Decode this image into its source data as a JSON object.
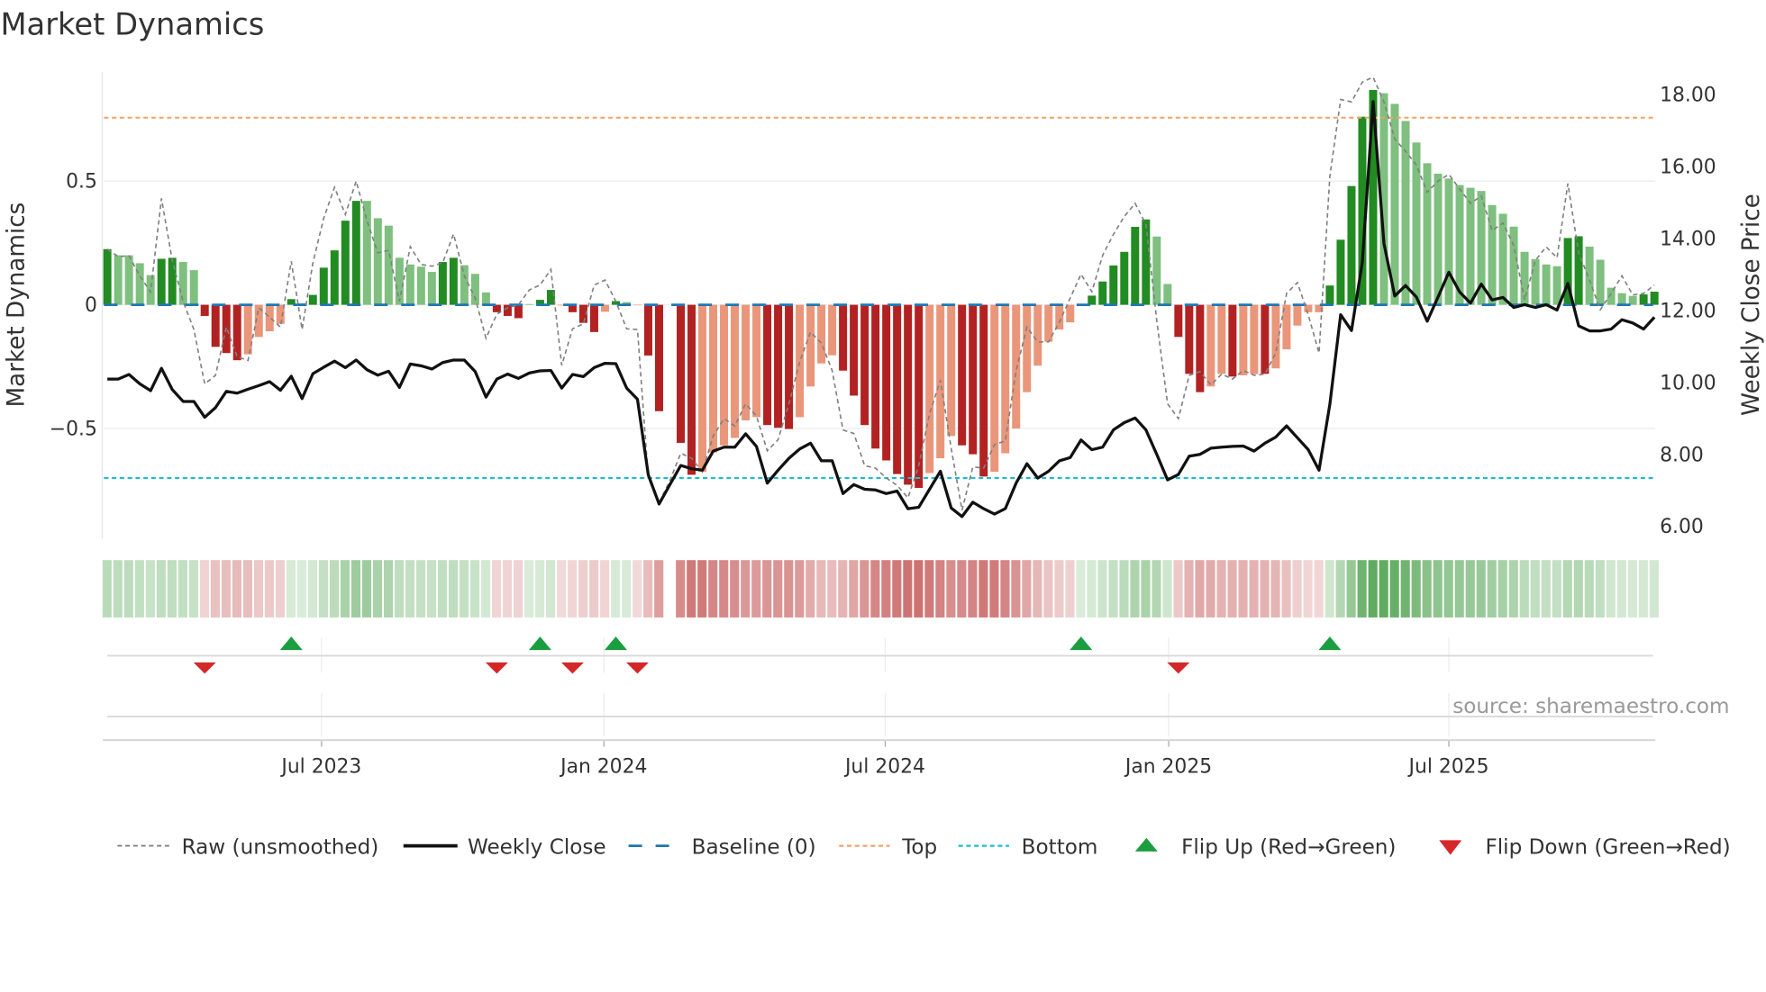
{
  "title": "Market Dynamics",
  "source": "source: sharemaestro.com",
  "colors": {
    "strong_up": "#228b22",
    "weak_up": "#7fbf7f",
    "strong_down": "#b22222",
    "weak_down": "#e9967a",
    "close": "#111111",
    "raw": "#808080",
    "baseline": "#1f77b4",
    "top": "#f4a261",
    "bottom": "#17becf",
    "flip_up": "#1a9e3f",
    "flip_down": "#d62728"
  },
  "chart_data": {
    "type": "bar",
    "title": "Market Dynamics",
    "ylabel": "Market Dynamics",
    "ylabel_right": "Weekly Close Price",
    "ylim": [
      -0.95,
      0.95
    ],
    "ylim_right": [
      5.7,
      18.8
    ],
    "y_ticks": [
      {
        "value": 0.5,
        "label": "0.5"
      },
      {
        "value": 0,
        "label": "0"
      },
      {
        "value": -0.5,
        "label": "−0.5"
      }
    ],
    "y_ticks_right": [
      {
        "value": 18,
        "label": "18.00"
      },
      {
        "value": 16,
        "label": "16.00"
      },
      {
        "value": 14,
        "label": "14.00"
      },
      {
        "value": 12,
        "label": "12.00"
      },
      {
        "value": 10,
        "label": "10.00"
      },
      {
        "value": 8,
        "label": "8.00"
      },
      {
        "value": 6,
        "label": "6.00"
      }
    ],
    "x_ticks": [
      {
        "week": 19.8,
        "label": "Jul 2023"
      },
      {
        "week": 45.9,
        "label": "Jan 2024"
      },
      {
        "week": 71.9,
        "label": "Jul 2024"
      },
      {
        "week": 98.1,
        "label": "Jan 2025"
      },
      {
        "week": 124.0,
        "label": "Jul 2025"
      }
    ],
    "top_level": 0.756,
    "bottom_level": -0.7,
    "baseline": 0,
    "momentum": [
      0.225,
      0.2,
      0.2,
      0.168,
      0.12,
      0.186,
      0.19,
      0.173,
      0.14,
      -0.045,
      -0.17,
      -0.195,
      -0.224,
      -0.2,
      -0.13,
      -0.107,
      -0.077,
      0.023,
      0.005,
      0.04,
      0.15,
      0.22,
      0.34,
      0.42,
      0.42,
      0.35,
      0.32,
      0.19,
      0.163,
      0.154,
      0.133,
      0.173,
      0.19,
      0.16,
      0.125,
      0.05,
      -0.03,
      -0.045,
      -0.054,
      0.003,
      0.02,
      0.06,
      -0.003,
      -0.03,
      -0.073,
      -0.11,
      -0.028,
      0.015,
      0.011,
      -0.002,
      -0.205,
      -0.43,
      null,
      -0.558,
      -0.687,
      -0.675,
      -0.597,
      -0.568,
      -0.538,
      -0.467,
      -0.454,
      -0.486,
      -0.497,
      -0.502,
      -0.454,
      -0.33,
      -0.237,
      -0.204,
      -0.266,
      -0.367,
      -0.486,
      -0.581,
      -0.629,
      -0.684,
      -0.727,
      -0.74,
      -0.68,
      -0.62,
      -0.53,
      -0.568,
      -0.604,
      -0.694,
      -0.675,
      -0.6,
      -0.5,
      -0.353,
      -0.246,
      -0.149,
      -0.1,
      -0.071,
      0,
      0.037,
      0.094,
      0.159,
      0.214,
      0.315,
      0.345,
      0.276,
      0.084,
      -0.13,
      -0.279,
      -0.353,
      -0.33,
      -0.279,
      -0.29,
      -0.285,
      -0.28,
      -0.279,
      -0.257,
      -0.18,
      -0.084,
      -0.03,
      -0.03,
      0.078,
      0.263,
      0.48,
      0.76,
      0.868,
      0.855,
      0.812,
      0.743,
      0.656,
      0.572,
      0.53,
      0.51,
      0.484,
      0.473,
      0.46,
      0.403,
      0.368,
      0.316,
      0.214,
      0.185,
      0.163,
      0.156,
      0.27,
      0.277,
      0.235,
      0.182,
      0.069,
      0.047,
      0.036,
      0.042,
      0.053
    ],
    "bar_strong": [
      1,
      0,
      0,
      0,
      0,
      1,
      1,
      0,
      0,
      1,
      1,
      1,
      1,
      0,
      0,
      0,
      0,
      1,
      1,
      1,
      1,
      1,
      1,
      1,
      0,
      0,
      0,
      0,
      0,
      0,
      0,
      1,
      1,
      0,
      0,
      0,
      1,
      1,
      1,
      0,
      1,
      1,
      0,
      1,
      1,
      1,
      0,
      1,
      0,
      0,
      1,
      1,
      0,
      1,
      1,
      0,
      0,
      0,
      0,
      0,
      0,
      1,
      1,
      1,
      0,
      0,
      0,
      0,
      1,
      1,
      1,
      1,
      1,
      1,
      1,
      1,
      0,
      0,
      0,
      1,
      1,
      1,
      0,
      0,
      0,
      0,
      0,
      0,
      0,
      0,
      0,
      1,
      1,
      1,
      1,
      1,
      1,
      0,
      0,
      1,
      1,
      1,
      0,
      0,
      1,
      0,
      0,
      1,
      0,
      0,
      0,
      0,
      0,
      1,
      1,
      1,
      1,
      1,
      0,
      0,
      0,
      0,
      0,
      0,
      0,
      0,
      0,
      0,
      0,
      0,
      0,
      0,
      0,
      0,
      0,
      1,
      1,
      0,
      0,
      0,
      0,
      0,
      1,
      1
    ],
    "raw": [
      0.225,
      0.195,
      0.198,
      0.117,
      0.052,
      0.43,
      0.18,
      0.014,
      -0.1,
      -0.32,
      -0.285,
      -0.09,
      -0.21,
      -0.225,
      -0.012,
      -0.05,
      -0.09,
      0.176,
      -0.1,
      0.17,
      0.35,
      0.475,
      0.365,
      0.5,
      0.34,
      0.21,
      0.22,
      0.014,
      0.235,
      0.163,
      0.156,
      0.17,
      0.286,
      0.117,
      0.027,
      -0.135,
      -0.038,
      -0.012,
      0,
      0.06,
      0.08,
      0.143,
      -0.245,
      -0.097,
      -0.077,
      0.08,
      0.1,
      0.014,
      -0.097,
      -0.1,
      -0.7,
      -0.8,
      -0.71,
      -0.6,
      -0.62,
      -0.675,
      -0.53,
      -0.46,
      -0.49,
      -0.4,
      -0.45,
      -0.59,
      -0.545,
      -0.4,
      -0.23,
      -0.11,
      -0.155,
      -0.266,
      -0.506,
      -0.52,
      -0.65,
      -0.66,
      -0.7,
      -0.73,
      -0.78,
      -0.65,
      -0.44,
      -0.305,
      -0.58,
      -0.83,
      -0.655,
      -0.66,
      -0.565,
      -0.55,
      -0.266,
      -0.09,
      -0.15,
      -0.15,
      -0.07,
      0.027,
      0.124,
      0.053,
      0.2,
      0.285,
      0.357,
      0.41,
      0.325,
      -0.064,
      -0.4,
      -0.46,
      -0.285,
      -0.27,
      -0.324,
      -0.28,
      -0.3,
      -0.265,
      -0.285,
      -0.28,
      -0.195,
      0.046,
      0.09,
      -0.04,
      -0.195,
      0.52,
      0.83,
      0.82,
      0.9,
      0.92,
      0.82,
      0.67,
      0.62,
      0.565,
      0.455,
      0.5,
      0.527,
      0.468,
      0.41,
      0.44,
      0.3,
      0.33,
      0.24,
      0.02,
      0.18,
      0.234,
      0.19,
      0.49,
      0.21,
      0.1,
      -0.02,
      0.046,
      0.117,
      0.04,
      0.046,
      0.08
    ],
    "close": [
      10.06,
      10.06,
      10.19,
      9.93,
      9.74,
      10.36,
      9.77,
      9.44,
      9.44,
      9.0,
      9.27,
      9.72,
      9.67,
      9.78,
      9.88,
      9.99,
      9.75,
      10.14,
      9.52,
      10.21,
      10.39,
      10.56,
      10.38,
      10.59,
      10.32,
      10.17,
      10.28,
      9.83,
      10.48,
      10.43,
      10.34,
      10.52,
      10.59,
      10.59,
      10.27,
      9.56,
      10.06,
      10.2,
      10.08,
      10.23,
      10.29,
      10.3,
      9.81,
      10.19,
      10.13,
      10.38,
      10.5,
      10.49,
      9.81,
      9.5,
      7.4,
      6.59,
      7.13,
      7.66,
      7.57,
      7.53,
      8.06,
      8.17,
      8.17,
      8.54,
      8.19,
      7.17,
      7.53,
      7.86,
      8.12,
      8.28,
      7.79,
      7.79,
      6.88,
      7.13,
      7.0,
      6.98,
      6.88,
      6.95,
      6.46,
      6.5,
      7.0,
      7.5,
      6.48,
      6.24,
      6.64,
      6.46,
      6.31,
      6.46,
      7.17,
      7.71,
      7.31,
      7.5,
      7.79,
      7.88,
      8.37,
      8.1,
      8.17,
      8.65,
      8.85,
      8.98,
      8.65,
      7.97,
      7.26,
      7.41,
      7.92,
      7.97,
      8.14,
      8.17,
      8.19,
      8.2,
      8.06,
      8.28,
      8.45,
      8.76,
      8.43,
      8.1,
      7.53,
      9.36,
      11.85,
      11.41,
      13.3,
      17.77,
      13.83,
      12.37,
      12.66,
      12.34,
      11.67,
      12.34,
      13.03,
      12.48,
      12.17,
      12.7,
      12.26,
      12.33,
      12.05,
      12.13,
      12.05,
      12.13,
      11.98,
      12.72,
      11.54,
      11.4,
      11.4,
      11.45,
      11.71,
      11.62,
      11.45,
      11.78
    ],
    "flip_up_weeks": [
      17,
      40,
      47,
      90,
      113
    ],
    "flip_down_weeks": [
      9,
      36,
      43,
      49,
      99
    ],
    "legend": [
      {
        "key": "raw",
        "label": "Raw (unsmoothed)"
      },
      {
        "key": "close",
        "label": "Weekly Close"
      },
      {
        "key": "baseline",
        "label": "Baseline (0)"
      },
      {
        "key": "top",
        "label": "Top"
      },
      {
        "key": "bottom",
        "label": "Bottom"
      },
      {
        "key": "flip_up",
        "label": "Flip Up (Red→Green)"
      },
      {
        "key": "flip_down",
        "label": "Flip Down (Green→Red)"
      }
    ],
    "legend_placement": "bottom"
  }
}
